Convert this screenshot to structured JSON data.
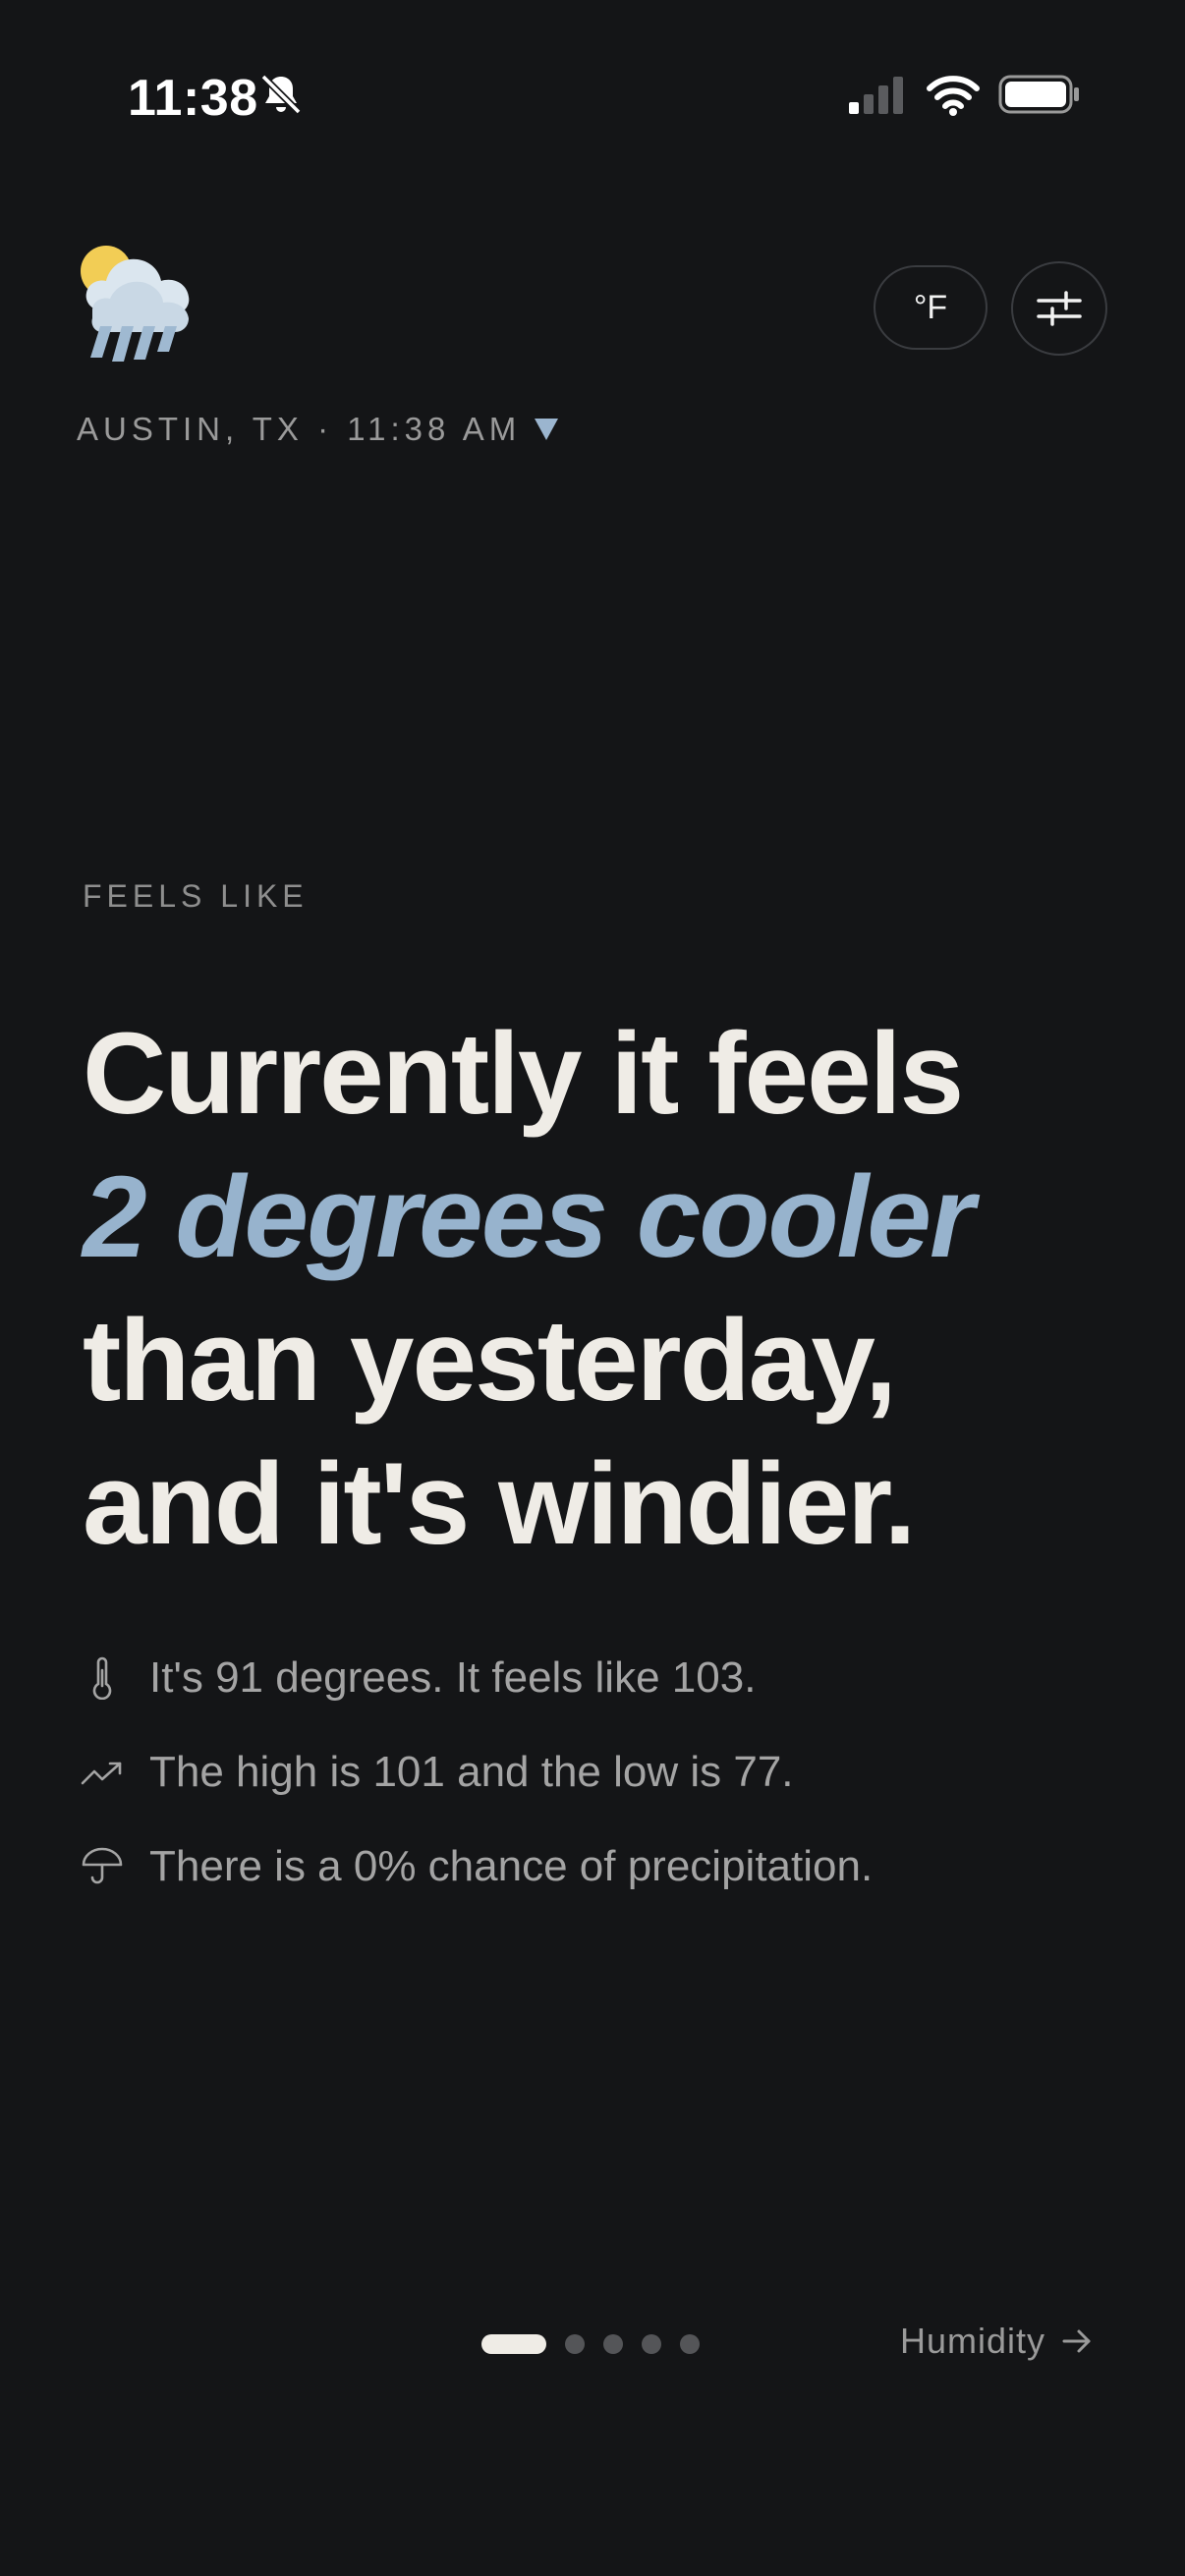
{
  "status_bar": {
    "time": "11:38",
    "icons": [
      "bell-slash-icon",
      "cellular-signal-icon",
      "wifi-icon",
      "battery-icon"
    ]
  },
  "header": {
    "weather_icon": "sun-behind-rain-cloud-icon",
    "unit_label": "°F",
    "settings_icon": "sliders-icon",
    "location": "AUSTIN, TX · 11:38 AM"
  },
  "main": {
    "section_label": "FEELS LIKE",
    "headline": {
      "line1": "Currently it feels",
      "accent": "2 degrees cooler",
      "line3": "than yesterday,",
      "line4": "and it's windier."
    },
    "details": [
      {
        "icon": "thermometer-icon",
        "text": "It's 91 degrees. It feels like 103."
      },
      {
        "icon": "trend-up-icon",
        "text": "The high is 101 and the low is 77."
      },
      {
        "icon": "umbrella-icon",
        "text": "There is a 0% chance of precipitation."
      }
    ]
  },
  "footer": {
    "pager": {
      "count": 5,
      "active_index": 0
    },
    "next_label": "Humidity"
  },
  "colors": {
    "background": "#141517",
    "headline": "#efece6",
    "accent": "#97b3cd",
    "muted": "#a4a4a4"
  }
}
